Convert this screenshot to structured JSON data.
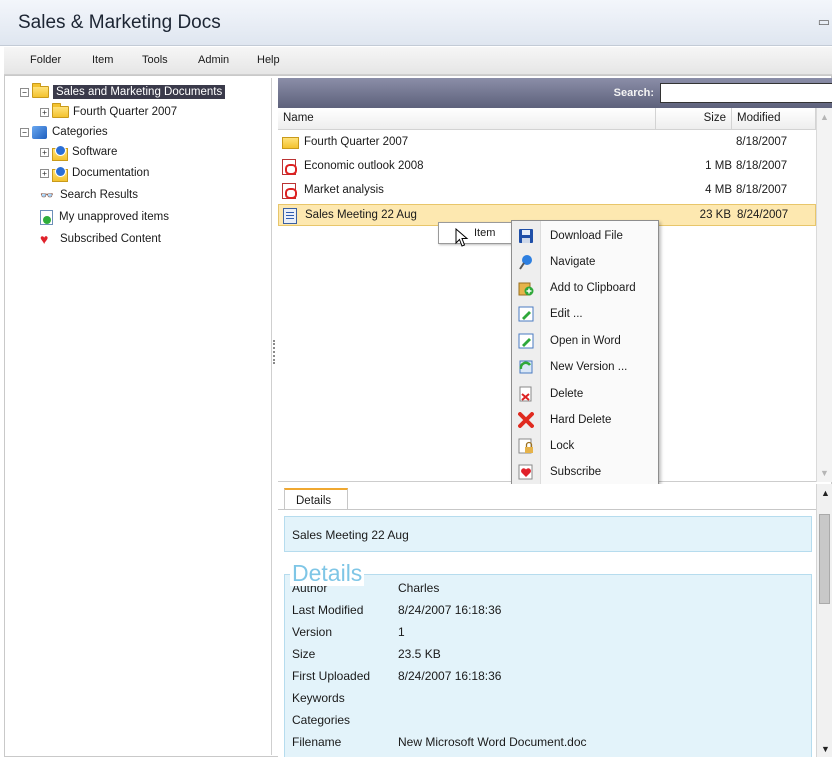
{
  "window": {
    "title": "Sales & Marketing Docs"
  },
  "menu": [
    "Folder",
    "Item",
    "Tools",
    "Admin",
    "Help"
  ],
  "tree": {
    "root": "Sales and Marketing Documents",
    "fourth_quarter": "Fourth Quarter 2007",
    "categories": "Categories",
    "software": "Software",
    "documentation": "Documentation",
    "search_results": "Search Results",
    "unapproved": "My unapproved items",
    "subscribed": "Subscribed Content"
  },
  "search": {
    "label": "Search:",
    "value": ""
  },
  "list": {
    "columns": {
      "name": "Name",
      "size": "Size",
      "modified": "Modified"
    },
    "rows": [
      {
        "name": "Fourth Quarter 2007",
        "size": "",
        "modified": "8/18/2007",
        "icon": "folder-icon"
      },
      {
        "name": "Economic outlook 2008",
        "size": "1 MB",
        "modified": "8/18/2007",
        "icon": "pdf-icon"
      },
      {
        "name": "Market analysis",
        "size": "4 MB",
        "modified": "8/18/2007",
        "icon": "pdf-icon"
      },
      {
        "name": "Sales Meeting 22 Aug",
        "size": "23 KB",
        "modified": "8/24/2007",
        "icon": "word-document-icon"
      }
    ]
  },
  "drag_tooltip": "Item",
  "context_menu": [
    {
      "label": "Download File",
      "icon": "save-disk-icon"
    },
    {
      "label": "Navigate",
      "icon": "navigate-pin-icon"
    },
    {
      "label": "Add to Clipboard",
      "icon": "clipboard-add-icon"
    },
    {
      "label": "Edit ...",
      "icon": "edit-icon"
    },
    {
      "label": "Open in Word",
      "icon": "open-in-word-icon"
    },
    {
      "label": "New Version ...",
      "icon": "new-version-icon"
    },
    {
      "label": "Delete",
      "icon": "delete-icon"
    },
    {
      "label": "Hard Delete",
      "icon": "hard-delete-x-icon"
    },
    {
      "label": "Lock",
      "icon": "lock-icon"
    },
    {
      "label": "Subscribe",
      "icon": "subscribe-icon"
    }
  ],
  "details": {
    "tab": "Details",
    "item_title": "Sales Meeting 22 Aug",
    "heading": "Details",
    "fields": [
      {
        "key": "Author",
        "value": "Charles"
      },
      {
        "key": "Last Modified",
        "value": "8/24/2007 16:18:36"
      },
      {
        "key": "Version",
        "value": "1"
      },
      {
        "key": "Size",
        "value": "23.5 KB"
      },
      {
        "key": "First Uploaded",
        "value": "8/24/2007 16:18:36"
      },
      {
        "key": "Keywords",
        "value": ""
      },
      {
        "key": "Categories",
        "value": ""
      },
      {
        "key": "Filename",
        "value": "New Microsoft Word Document.doc"
      }
    ]
  },
  "colors": {
    "selected_row": "#fde8b0",
    "header_bar": "#6e7190",
    "details_panel": "#e3f3fa",
    "details_heading": "#7fc6e6"
  }
}
